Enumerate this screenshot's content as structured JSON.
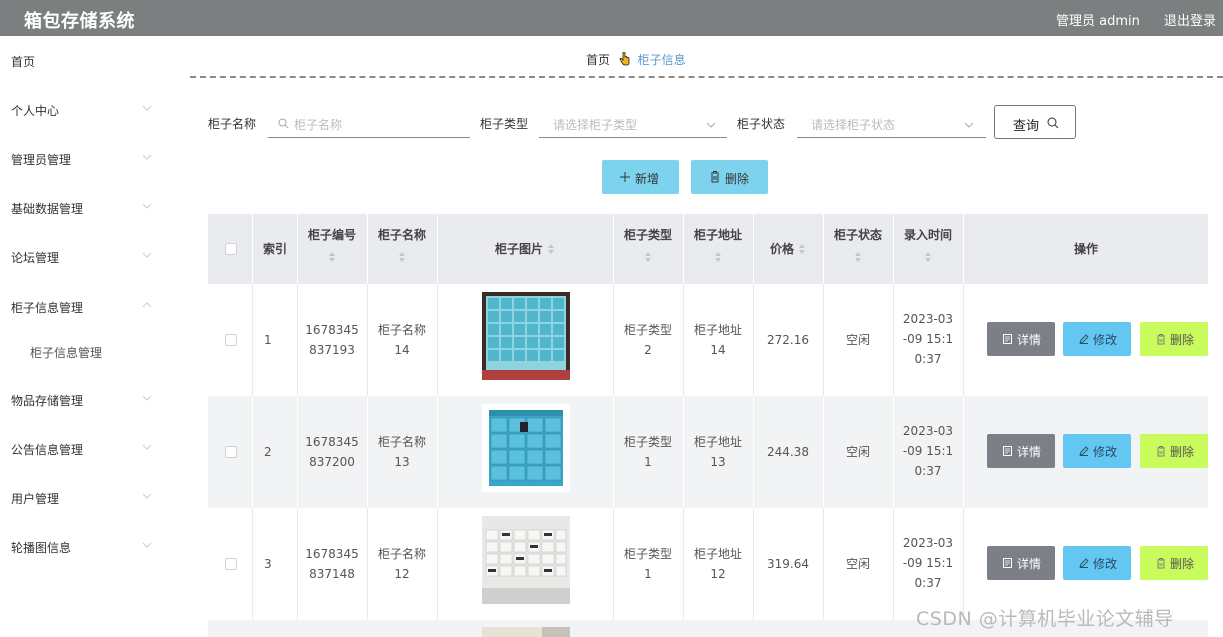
{
  "header": {
    "title": "箱包存储系统",
    "admin_label": "管理员 admin",
    "logout_label": "退出登录"
  },
  "sidebar": {
    "items": [
      {
        "label": "首页"
      },
      {
        "label": "个人中心"
      },
      {
        "label": "管理员管理"
      },
      {
        "label": "基础数据管理"
      },
      {
        "label": "论坛管理"
      },
      {
        "label": "柜子信息管理"
      },
      {
        "label": "柜子信息管理"
      },
      {
        "label": "物品存储管理"
      },
      {
        "label": "公告信息管理"
      },
      {
        "label": "用户管理"
      },
      {
        "label": "轮播图信息"
      }
    ]
  },
  "breadcrumb": {
    "home": "首页",
    "current": "柜子信息"
  },
  "search": {
    "name_label": "柜子名称",
    "name_placeholder": "柜子名称",
    "type_label": "柜子类型",
    "type_placeholder": "请选择柜子类型",
    "status_label": "柜子状态",
    "status_placeholder": "请选择柜子状态",
    "query_label": "查询"
  },
  "actions": {
    "add_label": "新增",
    "delete_label": "删除"
  },
  "table": {
    "headers": {
      "index": "索引",
      "code": "柜子编号",
      "name": "柜子名称",
      "image": "柜子图片",
      "type": "柜子类型",
      "address": "柜子地址",
      "price": "价格",
      "status": "柜子状态",
      "time": "录入时间",
      "ops": "操作"
    },
    "rows": [
      {
        "index": "1",
        "code_a": "1678345",
        "code_b": "837193",
        "name_a": "柜子名称",
        "name_b": "14",
        "type_a": "柜子类型",
        "type_b": "2",
        "addr_a": "柜子地址",
        "addr_b": "14",
        "price": "272.16",
        "status": "空闲",
        "time_a": "2023-03",
        "time_b": "-09 15:1",
        "time_c": "0:37"
      },
      {
        "index": "2",
        "code_a": "1678345",
        "code_b": "837200",
        "name_a": "柜子名称",
        "name_b": "13",
        "type_a": "柜子类型",
        "type_b": "1",
        "addr_a": "柜子地址",
        "addr_b": "13",
        "price": "244.38",
        "status": "空闲",
        "time_a": "2023-03",
        "time_b": "-09 15:1",
        "time_c": "0:37"
      },
      {
        "index": "3",
        "code_a": "1678345",
        "code_b": "837148",
        "name_a": "柜子名称",
        "name_b": "12",
        "type_a": "柜子类型",
        "type_b": "1",
        "addr_a": "柜子地址",
        "addr_b": "12",
        "price": "319.64",
        "status": "空闲",
        "time_a": "2023-03",
        "time_b": "-09 15:1",
        "time_c": "0:37"
      }
    ],
    "op_labels": {
      "detail": "详情",
      "edit": "修改",
      "delete": "删除"
    }
  },
  "watermark": "CSDN @计算机毕业论文辅导",
  "colors": {
    "header_bg": "#7b7f80",
    "action_btn": "#7dd3ed",
    "detail_btn": "#7b8086",
    "edit_btn": "#62c8f2",
    "delete_btn": "#c9fb5c",
    "row_alt": "#f2f3f5",
    "table_head": "#e9ebee"
  }
}
